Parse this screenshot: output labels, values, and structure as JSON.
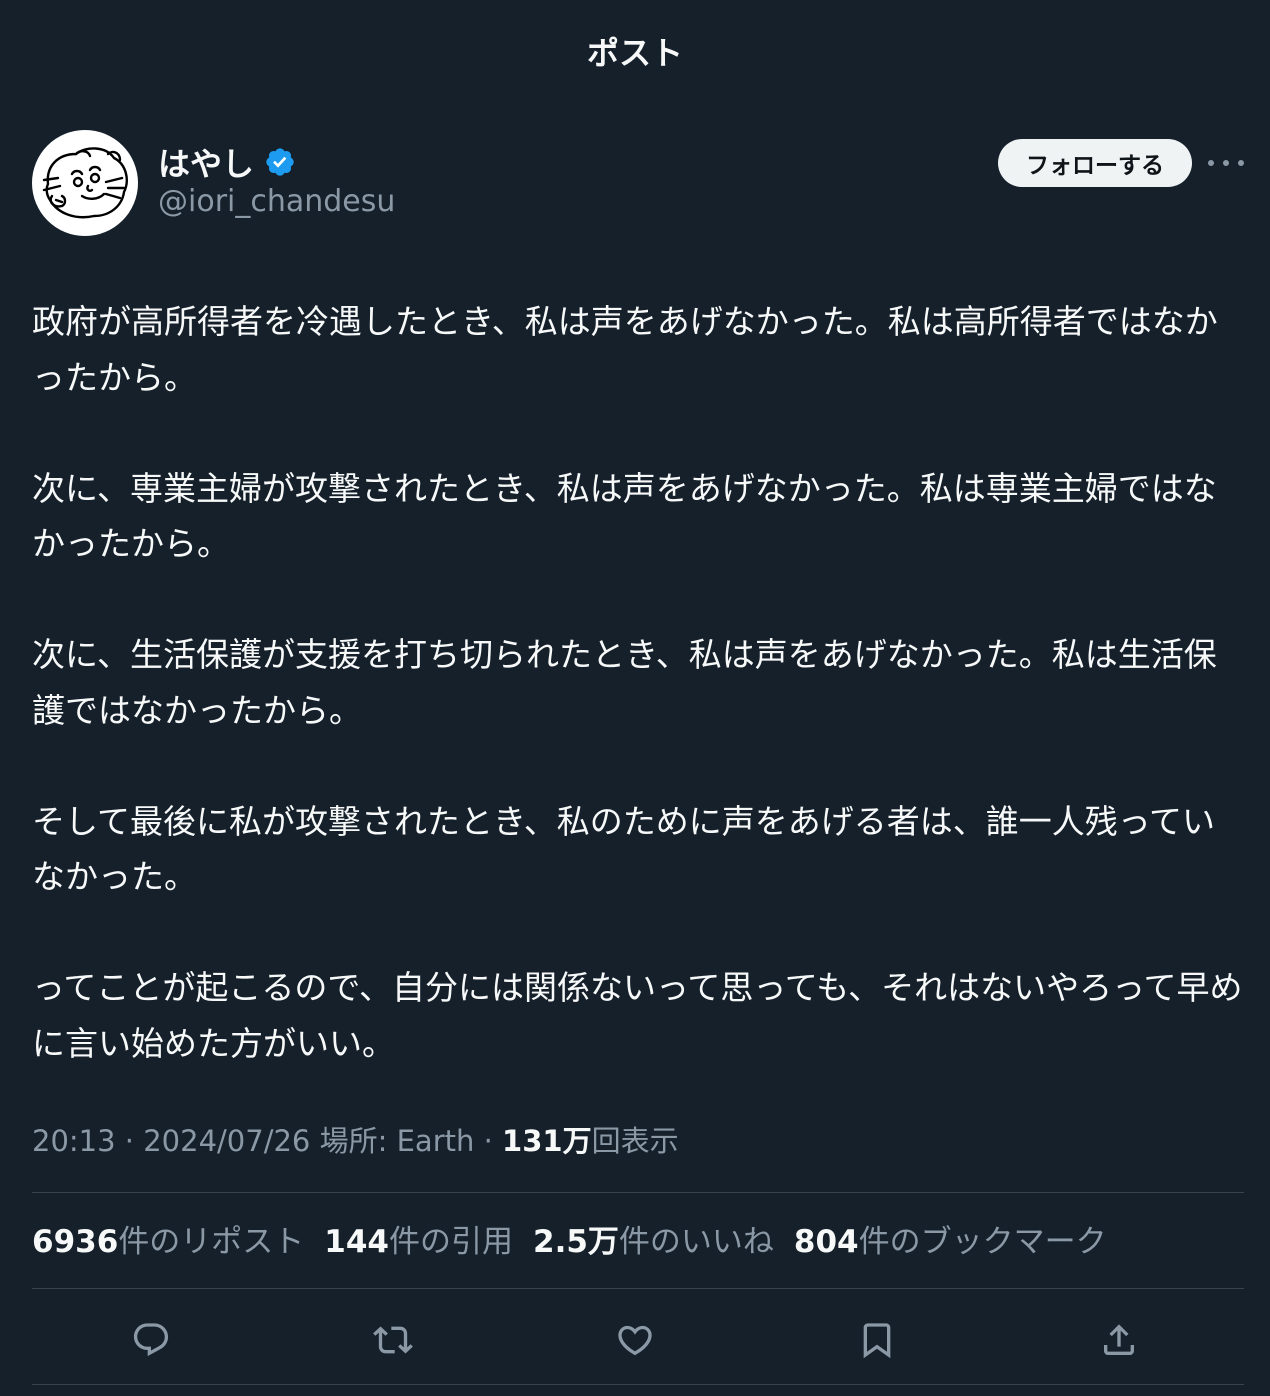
{
  "header": {
    "title": "ポスト"
  },
  "author": {
    "display_name": "はやし",
    "handle": "@iori_chandesu",
    "verified": true,
    "verified_color": "#1d9bf0"
  },
  "follow_button_label": "フォローする",
  "tweet": {
    "paragraphs": [
      "政府が高所得者を冷遇したとき、私は声をあげなかった。私は高所得者ではなかったから。",
      "次に、専業主婦が攻撃されたとき、私は声をあげなかった。私は専業主婦ではなかったから。",
      "次に、生活保護が支援を打ち切られたとき、私は声をあげなかった。私は生活保護ではなかったから。",
      "そして最後に私が攻撃されたとき、私のために声をあげる者は、誰一人残っていなかった。",
      "ってことが起こるので、自分には関係ないって思っても、それはないやろって早めに言い始めた方がいい。"
    ]
  },
  "meta": {
    "time": "20:13",
    "sep1": " · ",
    "date": "2024/07/26",
    "location_label": "場所: ",
    "location": "Earth",
    "sep2": " · ",
    "views_count": "131万",
    "views_label": "回表示"
  },
  "stats": {
    "reposts_count": "6936",
    "reposts_label": "件のリポスト",
    "quotes_count": "144",
    "quotes_label": "件の引用",
    "likes_count": "2.5万",
    "likes_label": "件のいいね",
    "bookmarks_count": "804",
    "bookmarks_label": "件のブックマーク"
  },
  "actions": {
    "icons": [
      "reply-icon",
      "retweet-icon",
      "like-icon",
      "bookmark-icon",
      "share-icon"
    ]
  },
  "colors": {
    "background": "#15202b",
    "text_primary": "#f7f9f9",
    "text_secondary": "#8b98a5",
    "divider": "#38444d",
    "follow_button_bg": "#eff3f4"
  }
}
